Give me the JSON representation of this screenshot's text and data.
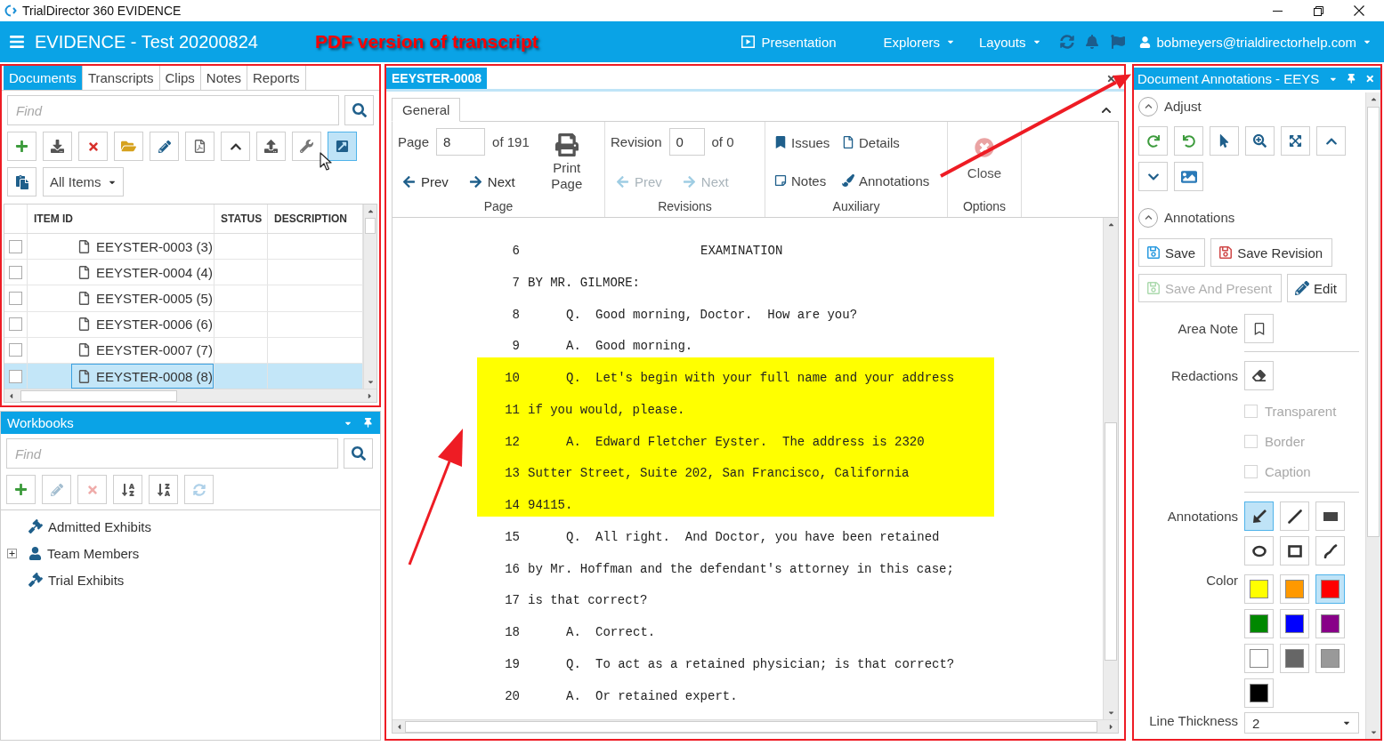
{
  "window": {
    "title": "TrialDirector 360 EVIDENCE"
  },
  "app_bar": {
    "title": "EVIDENCE - Test 20200824",
    "menus": [
      {
        "label": "Presentation",
        "kind": "presentation"
      },
      {
        "label": "Explorers",
        "kind": "dropdown"
      },
      {
        "label": "Layouts",
        "kind": "dropdown"
      }
    ],
    "user": "bobmeyers@trialdirectorhelp.com"
  },
  "callout": {
    "text": "PDF version of transcript"
  },
  "documents": {
    "tabs": [
      {
        "label": "Documents",
        "selected": true
      },
      {
        "label": "Transcripts",
        "selected": false
      },
      {
        "label": "Clips",
        "selected": false
      },
      {
        "label": "Notes",
        "selected": false
      },
      {
        "label": "Reports",
        "selected": false
      }
    ],
    "search": {
      "placeholder": "Find"
    },
    "toolbar": [
      {
        "kind": "add",
        "selected": false
      },
      {
        "kind": "import",
        "selected": false
      },
      {
        "kind": "delete",
        "selected": false
      },
      {
        "kind": "open",
        "selected": false
      },
      {
        "kind": "edit",
        "selected": false
      },
      {
        "kind": "pdf",
        "selected": false
      },
      {
        "kind": "up",
        "selected": false
      },
      {
        "kind": "export",
        "selected": false
      },
      {
        "kind": "tools",
        "selected": false
      },
      {
        "kind": "popout",
        "selected": true
      },
      {
        "kind": "paste",
        "selected": false
      }
    ],
    "filter": {
      "value": "All Items"
    },
    "table": {
      "columns": [
        "ITEM ID",
        "STATUS",
        "DESCRIPTION"
      ],
      "rows": [
        {
          "item_id": "EEYSTER-0003 (3)",
          "checked": false,
          "selected": false
        },
        {
          "item_id": "EEYSTER-0004 (4)",
          "checked": false,
          "selected": false
        },
        {
          "item_id": "EEYSTER-0005 (5)",
          "checked": false,
          "selected": false
        },
        {
          "item_id": "EEYSTER-0006 (6)",
          "checked": false,
          "selected": false
        },
        {
          "item_id": "EEYSTER-0007 (7)",
          "checked": false,
          "selected": false
        },
        {
          "item_id": "EEYSTER-0008 (8)",
          "checked": false,
          "selected": true
        }
      ]
    }
  },
  "workbooks": {
    "title": "Workbooks",
    "search": {
      "placeholder": "Find"
    },
    "toolbar": [
      {
        "kind": "add",
        "disabled": false
      },
      {
        "kind": "edit",
        "disabled": true
      },
      {
        "kind": "delete",
        "disabled": true
      },
      {
        "kind": "sort-asc",
        "disabled": false
      },
      {
        "kind": "sort-desc",
        "disabled": false
      },
      {
        "kind": "refresh",
        "disabled": true
      }
    ],
    "tree": [
      {
        "label": "Admitted Exhibits",
        "kind": "gavel",
        "expandable": false
      },
      {
        "label": "Team Members",
        "kind": "person",
        "expandable": true,
        "expanded": false
      },
      {
        "label": "Trial Exhibits",
        "kind": "gavel",
        "expandable": false
      }
    ]
  },
  "viewer": {
    "tab": "EEYSTER-0008",
    "ribbon_tab": "General",
    "page_group": {
      "caption": "Page",
      "field_label": "Page",
      "value": "8",
      "total": "of 191",
      "nav": [
        {
          "label": "Prev",
          "kind": "prev",
          "disabled": false
        },
        {
          "label": "Next",
          "kind": "next",
          "disabled": false
        }
      ],
      "print": "Print Page"
    },
    "revisions_group": {
      "caption": "Revisions",
      "field_label": "Revision",
      "value": "0",
      "total": "of 0",
      "nav": [
        {
          "label": "Prev",
          "kind": "prev",
          "disabled": true
        },
        {
          "label": "Next",
          "kind": "next",
          "disabled": true
        }
      ]
    },
    "auxiliary_group": {
      "caption": "Auxiliary",
      "buttons": [
        {
          "label": "Issues",
          "kind": "issues"
        },
        {
          "label": "Details",
          "kind": "details"
        },
        {
          "label": "Notes",
          "kind": "notes"
        },
        {
          "label": "Annotations",
          "kind": "annotations"
        }
      ]
    },
    "options_group": {
      "caption": "Options",
      "buttons": [
        {
          "label": "Close",
          "kind": "close"
        }
      ]
    },
    "transcript": [
      {
        "number": "6",
        "kind": "heading",
        "text": "EXAMINATION",
        "highlighted": false
      },
      {
        "number": "7",
        "kind": "plain",
        "text": "BY MR. GILMORE:",
        "highlighted": false
      },
      {
        "number": "8",
        "kind": "testimony",
        "speaker": "Q.",
        "text": "Good morning, Doctor.  How are you?",
        "highlighted": false
      },
      {
        "number": "9",
        "kind": "testimony",
        "speaker": "A.",
        "text": "Good morning.",
        "highlighted": false
      },
      {
        "number": "10",
        "kind": "testimony",
        "speaker": "Q.",
        "text": "Let's begin with your full name and your address",
        "highlighted": true
      },
      {
        "number": "11",
        "kind": "plain",
        "text": "if you would, please.",
        "highlighted": true
      },
      {
        "number": "12",
        "kind": "testimony",
        "speaker": "A.",
        "text": "Edward Fletcher Eyster.  The address is 2320",
        "highlighted": true
      },
      {
        "number": "13",
        "kind": "plain",
        "text": "Sutter Street, Suite 202, San Francisco, California",
        "highlighted": true
      },
      {
        "number": "14",
        "kind": "plain",
        "text": "94115.",
        "highlighted": true
      },
      {
        "number": "15",
        "kind": "testimony",
        "speaker": "Q.",
        "text": "All right.  And Doctor, you have been retained",
        "highlighted": false
      },
      {
        "number": "16",
        "kind": "plain",
        "text": "by Mr. Hoffman and the defendant's attorney in this case;",
        "highlighted": false
      },
      {
        "number": "17",
        "kind": "plain",
        "text": "is that correct?",
        "highlighted": false
      },
      {
        "number": "18",
        "kind": "testimony",
        "speaker": "A.",
        "text": "Correct.",
        "highlighted": false
      },
      {
        "number": "19",
        "kind": "testimony",
        "speaker": "Q.",
        "text": "To act as a retained physician; is that correct?",
        "highlighted": false
      },
      {
        "number": "20",
        "kind": "testimony",
        "speaker": "A.",
        "text": "Or retained expert.",
        "highlighted": false
      }
    ]
  },
  "annotations": {
    "title": "Document Annotations - EEYS",
    "adjust": {
      "title": "Adjust",
      "expanded": true,
      "tools": [
        {
          "kind": "rotate-right"
        },
        {
          "kind": "rotate-left"
        },
        {
          "kind": "select"
        },
        {
          "kind": "zoom"
        },
        {
          "kind": "fit"
        },
        {
          "kind": "up"
        },
        {
          "kind": "down"
        },
        {
          "kind": "image"
        }
      ]
    },
    "annotate": {
      "title": "Annotations",
      "expanded": true,
      "buttons": [
        {
          "label": "Save",
          "kind": "save",
          "disabled": false
        },
        {
          "label": "Save Revision",
          "kind": "save-revision",
          "disabled": false
        },
        {
          "label": "Save And Present",
          "kind": "save-present",
          "disabled": true
        },
        {
          "label": "Edit",
          "kind": "edit",
          "disabled": false
        }
      ],
      "area_note": {
        "label": "Area Note"
      },
      "redactions": {
        "label": "Redactions",
        "options": [
          {
            "label": "Transparent",
            "checked": false,
            "disabled": true
          },
          {
            "label": "Border",
            "checked": false,
            "disabled": true
          },
          {
            "label": "Caption",
            "checked": false,
            "disabled": true
          }
        ]
      },
      "shapes": {
        "label": "Annotations",
        "tools": [
          {
            "kind": "arrow",
            "selected": true
          },
          {
            "kind": "line",
            "selected": false
          },
          {
            "kind": "highlight",
            "selected": false
          },
          {
            "kind": "ellipse",
            "selected": false
          },
          {
            "kind": "rectangle",
            "selected": false
          },
          {
            "kind": "freehand",
            "selected": false
          }
        ]
      },
      "colors": {
        "label": "Color",
        "swatches": [
          {
            "color": "#ffff00",
            "selected": false
          },
          {
            "color": "#ff9900",
            "selected": false
          },
          {
            "color": "#ff0000",
            "selected": true
          },
          {
            "color": "#008800",
            "selected": false
          },
          {
            "color": "#0000ff",
            "selected": false
          },
          {
            "color": "#880088",
            "selected": false
          },
          {
            "color": "#ffffff",
            "selected": false
          },
          {
            "color": "#666666",
            "selected": false
          },
          {
            "color": "#999999",
            "selected": false
          },
          {
            "color": "#000000",
            "selected": false
          }
        ]
      },
      "line_thickness": {
        "label": "Line Thickness",
        "value": "2"
      }
    }
  }
}
